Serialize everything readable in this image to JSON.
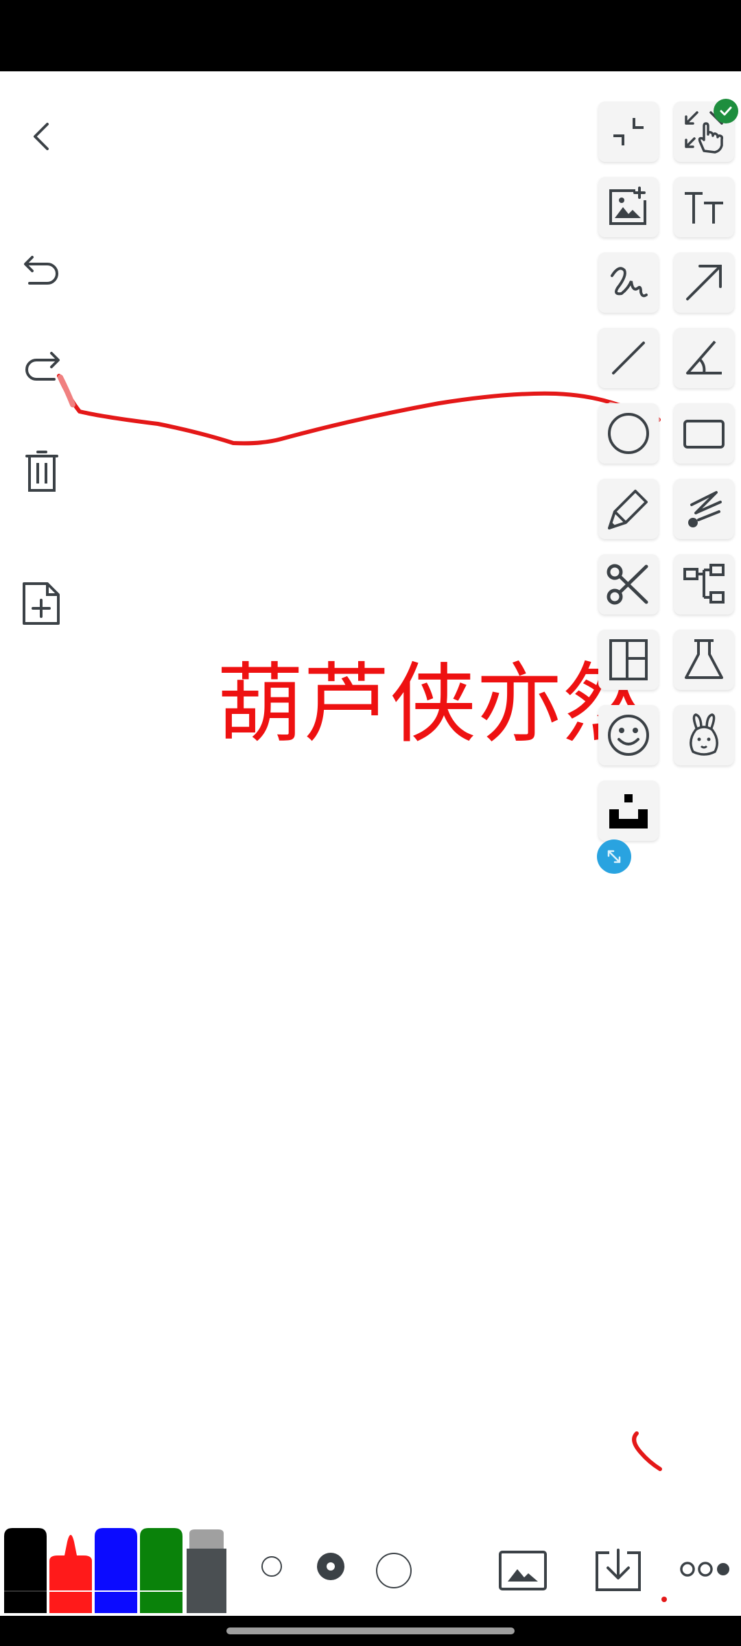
{
  "canvas": {
    "text": "葫芦侠亦然",
    "text_color": "#ee1111",
    "stroke_color": "#e41818"
  },
  "left_toolbar": [
    "back-icon",
    "undo-icon",
    "redo-icon",
    "delete-icon",
    "new-page-icon"
  ],
  "right_toolbar": [
    "shrink-icon",
    "select-hand-icon",
    "insert-image-icon",
    "text-size-icon",
    "freehand-icon",
    "arrow-icon",
    "line-icon",
    "angle-icon",
    "circle-icon",
    "rectangle-icon",
    "highlighter-icon",
    "laser-pointer-icon",
    "scissors-icon",
    "mind-map-icon",
    "layout-grid-icon",
    "flask-icon",
    "smiley-icon",
    "rabbit-icon",
    "stamp-icon"
  ],
  "text_tool_label": "TT",
  "pen_colors": [
    "#000000",
    "#ff1a1a",
    "#0b0bff",
    "#0a820a",
    "#4a4f52"
  ],
  "selected_pen_color": "#ff1a1a",
  "stroke_sizes": [
    "small",
    "medium",
    "large"
  ],
  "selected_stroke_size": "medium",
  "bottom_actions": [
    "gallery-icon",
    "download-icon",
    "more-icon"
  ],
  "accent_green": "#1e8e3e",
  "accent_blue": "#29a3e0"
}
